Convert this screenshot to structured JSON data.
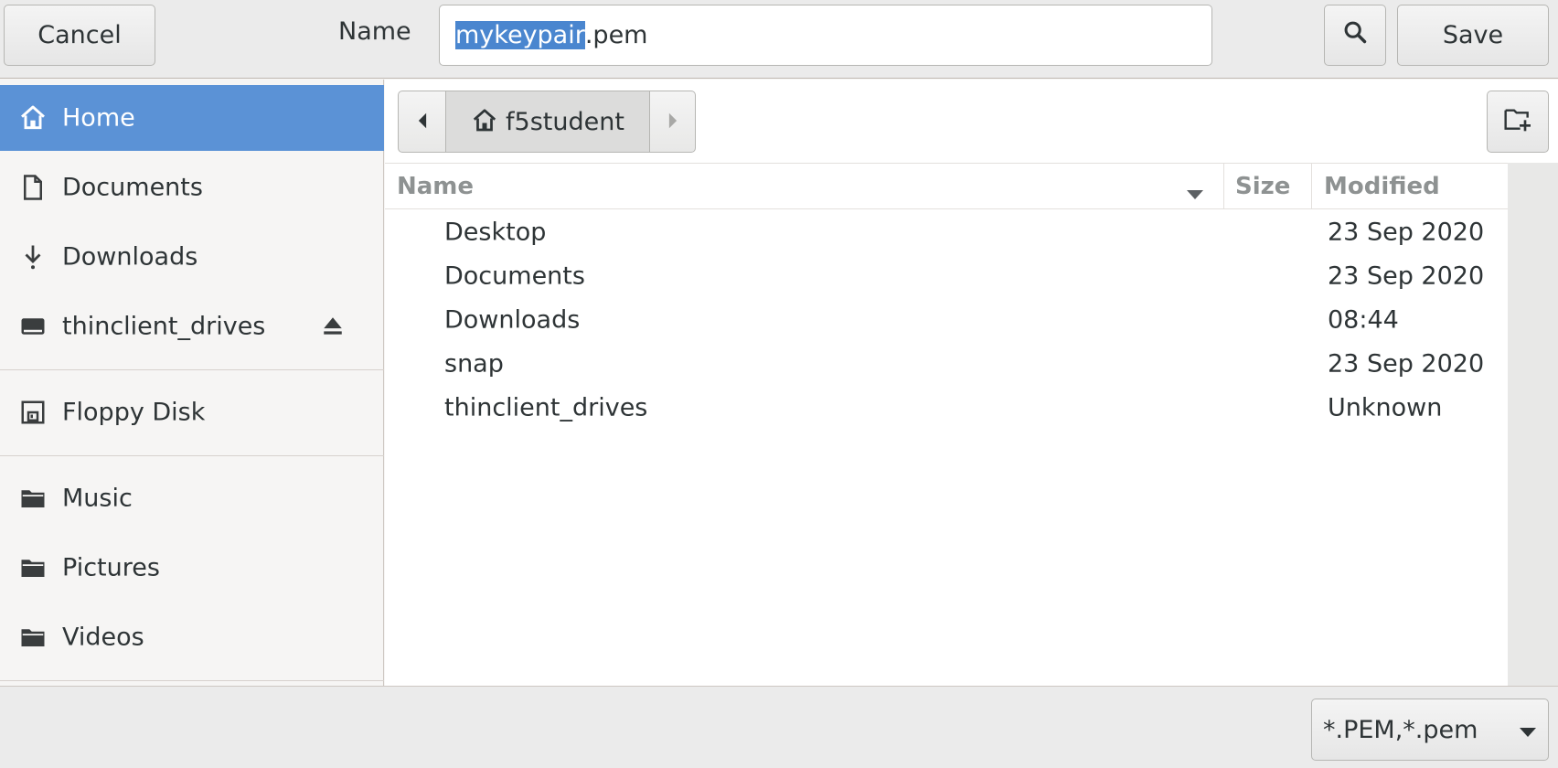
{
  "header": {
    "cancel_label": "Cancel",
    "name_label": "Name",
    "filename_selected": "mykeypair",
    "filename_rest": ".pem",
    "save_label": "Save",
    "search_icon": "search-icon"
  },
  "sidebar": {
    "items": [
      {
        "label": "Home",
        "icon": "home-icon",
        "active": true
      },
      {
        "label": "Documents",
        "icon": "document-icon"
      },
      {
        "label": "Downloads",
        "icon": "download-icon"
      },
      {
        "label": "thinclient_drives",
        "icon": "drive-icon",
        "eject": true
      },
      {
        "label": "Floppy Disk",
        "icon": "floppy-icon"
      },
      {
        "label": "Music",
        "icon": "folder-icon"
      },
      {
        "label": "Pictures",
        "icon": "folder-icon"
      },
      {
        "label": "Videos",
        "icon": "folder-icon"
      }
    ]
  },
  "pathbar": {
    "current": "f5student"
  },
  "filelist": {
    "columns": {
      "name": "Name",
      "size": "Size",
      "modified": "Modified"
    },
    "rows": [
      {
        "name": "Desktop",
        "size": "",
        "modified": "23 Sep 2020"
      },
      {
        "name": "Documents",
        "size": "",
        "modified": "23 Sep 2020"
      },
      {
        "name": "Downloads",
        "size": "",
        "modified": "08:44"
      },
      {
        "name": "snap",
        "size": "",
        "modified": "23 Sep 2020"
      },
      {
        "name": "thinclient_drives",
        "size": "",
        "modified": "Unknown"
      }
    ]
  },
  "footer": {
    "filter_label": "*.PEM,*.pem"
  },
  "colors": {
    "accent": "#5b92d6",
    "selection": "#4a86cf"
  }
}
